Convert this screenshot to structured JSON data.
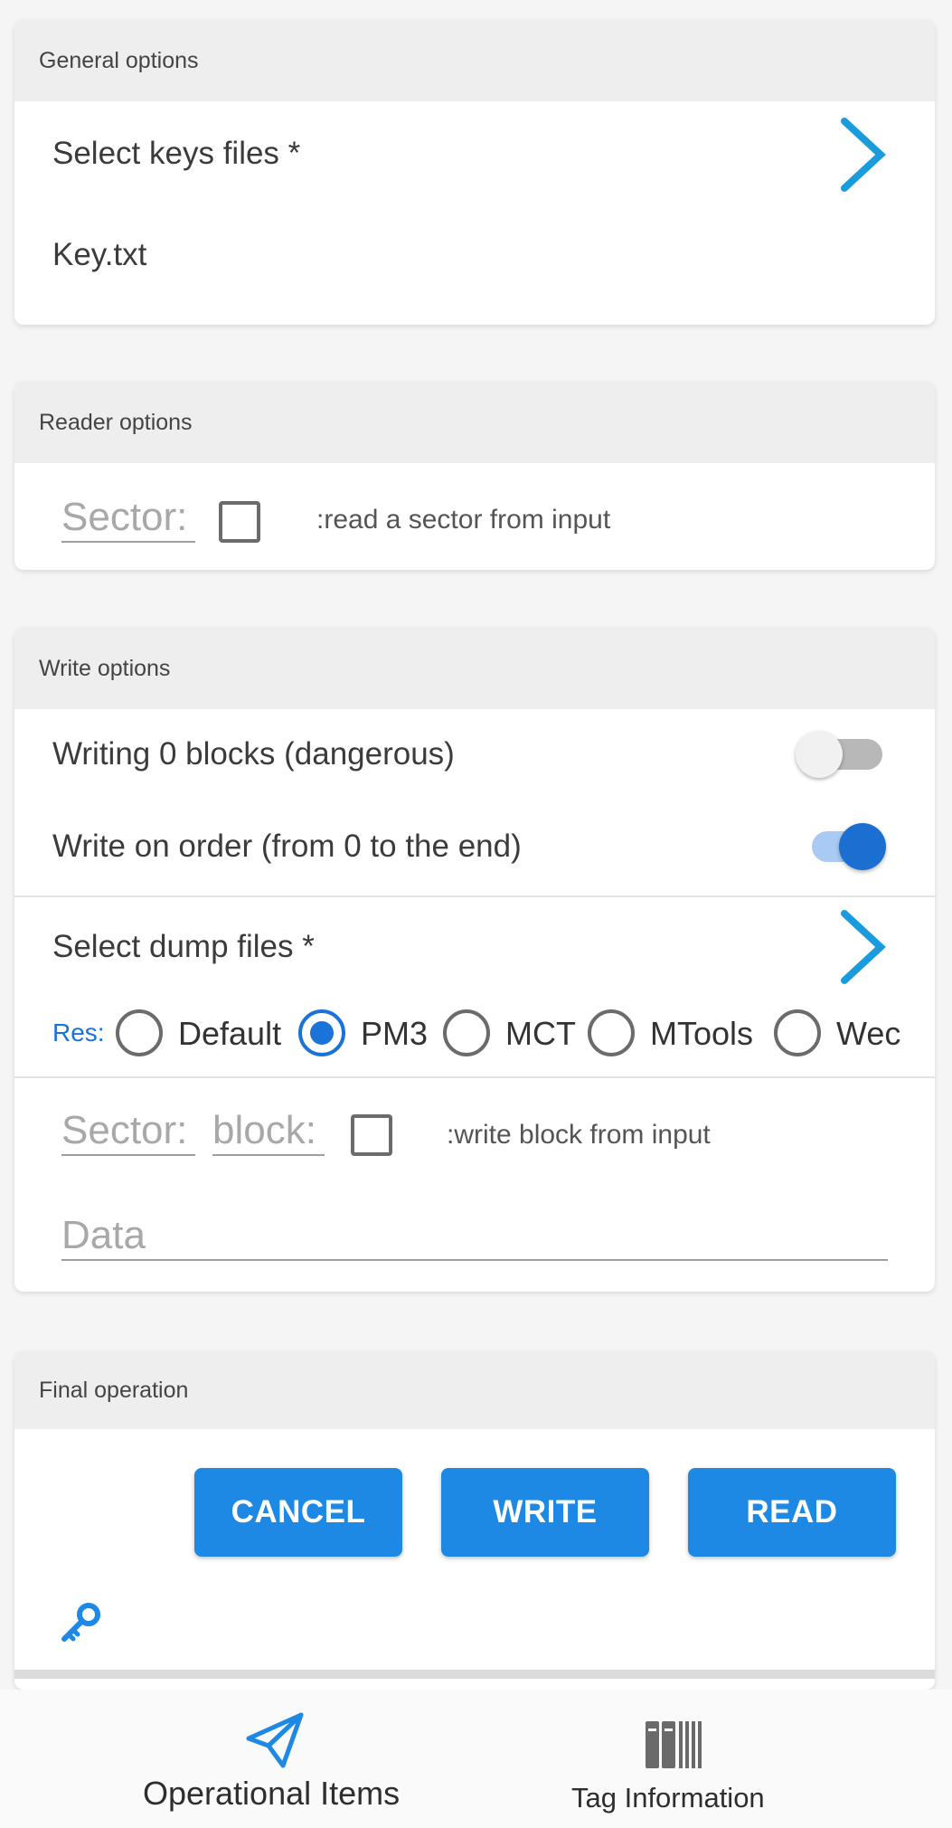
{
  "general": {
    "header": "General options",
    "select_keys_label": "Select keys files *",
    "key_file": "Key.txt"
  },
  "reader": {
    "header": "Reader options",
    "sector_placeholder": "Sector:",
    "note": ":read a sector from input",
    "checked": false
  },
  "write": {
    "header": "Write options",
    "zero_blocks_label": "Writing 0 blocks (dangerous)",
    "zero_blocks_on": false,
    "order_label": "Write on order (from 0 to the end)",
    "order_on": true,
    "select_dump_label": "Select dump files *",
    "res_label": "Res:",
    "res_options": [
      "Default",
      "PM3",
      "MCT",
      "MTools",
      "Wec"
    ],
    "res_selected": "PM3",
    "sector_placeholder": "Sector:",
    "block_placeholder": "block:",
    "note": ":write block from input",
    "data_placeholder": "Data"
  },
  "final": {
    "header": "Final operation",
    "cancel": "CANCEL",
    "write": "WRITE",
    "read": "READ"
  },
  "nav": {
    "item1": "Operational Items",
    "item2": "Tag Information"
  },
  "colors": {
    "accent": "#1e88e5",
    "chevron": "#1a9bdc",
    "background": "#f5f5f5"
  }
}
